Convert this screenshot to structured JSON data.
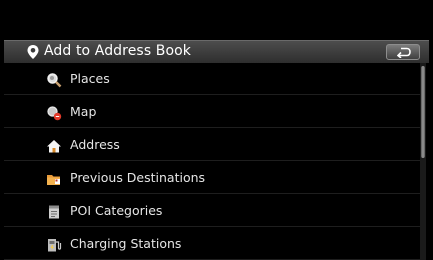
{
  "header": {
    "title": "Add to Address Book",
    "pin_icon": "location-pin-icon",
    "back_icon": "return-arrow-icon"
  },
  "menu": {
    "items": [
      {
        "label": "Places",
        "icon": "search-magnifier-icon"
      },
      {
        "label": "Map",
        "icon": "map-search-icon"
      },
      {
        "label": "Address",
        "icon": "house-icon"
      },
      {
        "label": "Previous Destinations",
        "icon": "folder-flag-icon"
      },
      {
        "label": "POI Categories",
        "icon": "document-icon"
      },
      {
        "label": "Charging Stations",
        "icon": "charging-station-icon"
      }
    ]
  },
  "colors": {
    "background": "#000000",
    "header": "#3b3b3b",
    "text": "#e6e6e6"
  }
}
